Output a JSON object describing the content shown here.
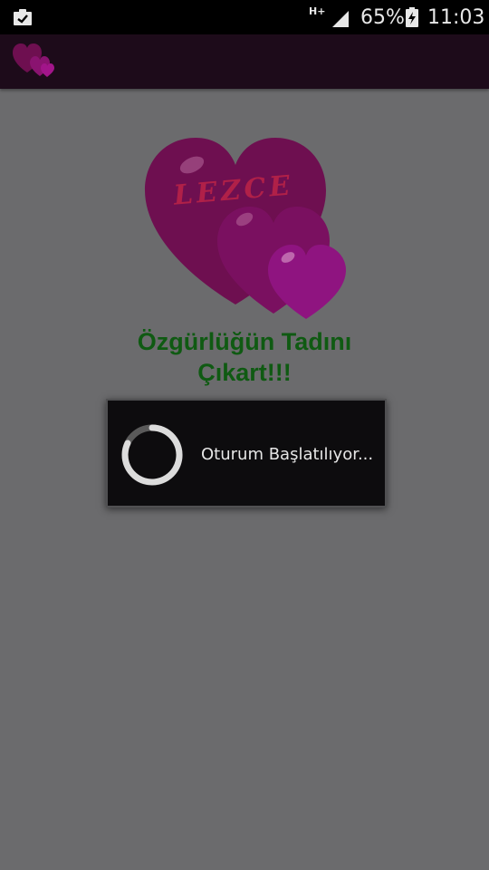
{
  "status_bar": {
    "notification_icon": "clipboard-check-icon",
    "network_type": "H+",
    "signal_icon": "signal-bars-icon",
    "battery_percent": "65%",
    "battery_icon": "battery-charging-icon",
    "time": "11:03"
  },
  "app_bar": {
    "icon": "hearts-app-icon"
  },
  "logo": {
    "text": "LEZCE",
    "icon": "three-hearts-logo"
  },
  "tagline": {
    "line1": "Özgürlüğün Tadını",
    "line2": "Çıkart!!!"
  },
  "progress_dialog": {
    "message": "Oturum Başlatılıyor...",
    "spinner_icon": "loading-spinner-icon"
  },
  "colors": {
    "background": "#6b6b6d",
    "app_bar": "#1d0b1a",
    "tagline": "#0f5a12",
    "heart_dark": "#6e0f50",
    "heart_light": "#8a1370",
    "dialog": "#0d0c0e"
  }
}
